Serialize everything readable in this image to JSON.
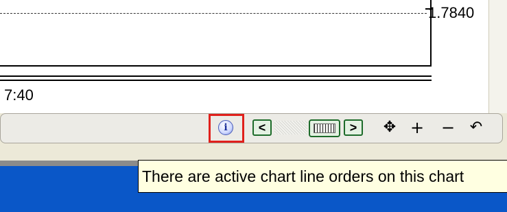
{
  "chart": {
    "price_label": "1.7840",
    "time_label": "7:40"
  },
  "toolbar": {
    "info_icon_glyph": "i",
    "scroll_left_glyph": "<",
    "scroll_right_glyph": ">",
    "pan_glyph": "✥",
    "zoom_in_glyph": "+",
    "zoom_out_glyph": "−",
    "undo_glyph": "↶",
    "highlight_color": "#e0201c",
    "nav_button_border_color": "#1d6b2a"
  },
  "tooltip": {
    "text": "There are active chart line orders on this chart"
  },
  "colors": {
    "taskbar_blue": "#0a57c8",
    "tooltip_bg": "#ffffe1"
  }
}
